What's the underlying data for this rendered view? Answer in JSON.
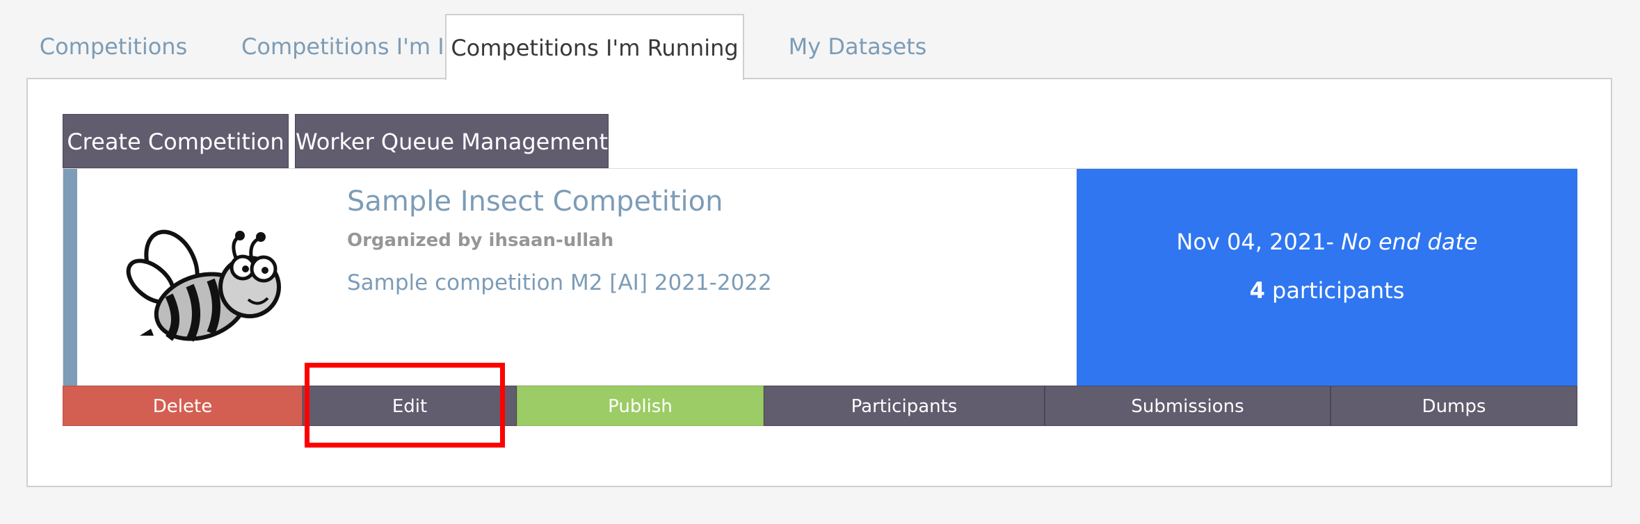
{
  "tabs": [
    {
      "label": "Competitions"
    },
    {
      "label": "Competitions I'm In"
    },
    {
      "label": "Competitions I'm Running"
    },
    {
      "label": "My Datasets"
    }
  ],
  "toolbar": {
    "create_label": "Create Competition",
    "worker_label": "Worker Queue Management"
  },
  "competition": {
    "title": "Sample Insect Competition",
    "organizer": "Organized by ihsaan-ullah",
    "description": "Sample competition M2 [AI] 2021-2022",
    "start_date": "Nov 04, 2021-",
    "end_date": "No end date",
    "participant_count": "4",
    "participants_suffix": "participants",
    "logo_icon": "bee-icon"
  },
  "actions": {
    "delete": "Delete",
    "edit": "Edit",
    "publish": "Publish",
    "participants": "Participants",
    "submissions": "Submissions",
    "dumps": "Dumps"
  },
  "colors": {
    "accent": "#7c9cb7",
    "info_bg": "#2f76f0",
    "delete": "#d35f52",
    "publish": "#9ccc65",
    "neutral_btn": "#615d6f",
    "highlight": "#ff0000"
  }
}
